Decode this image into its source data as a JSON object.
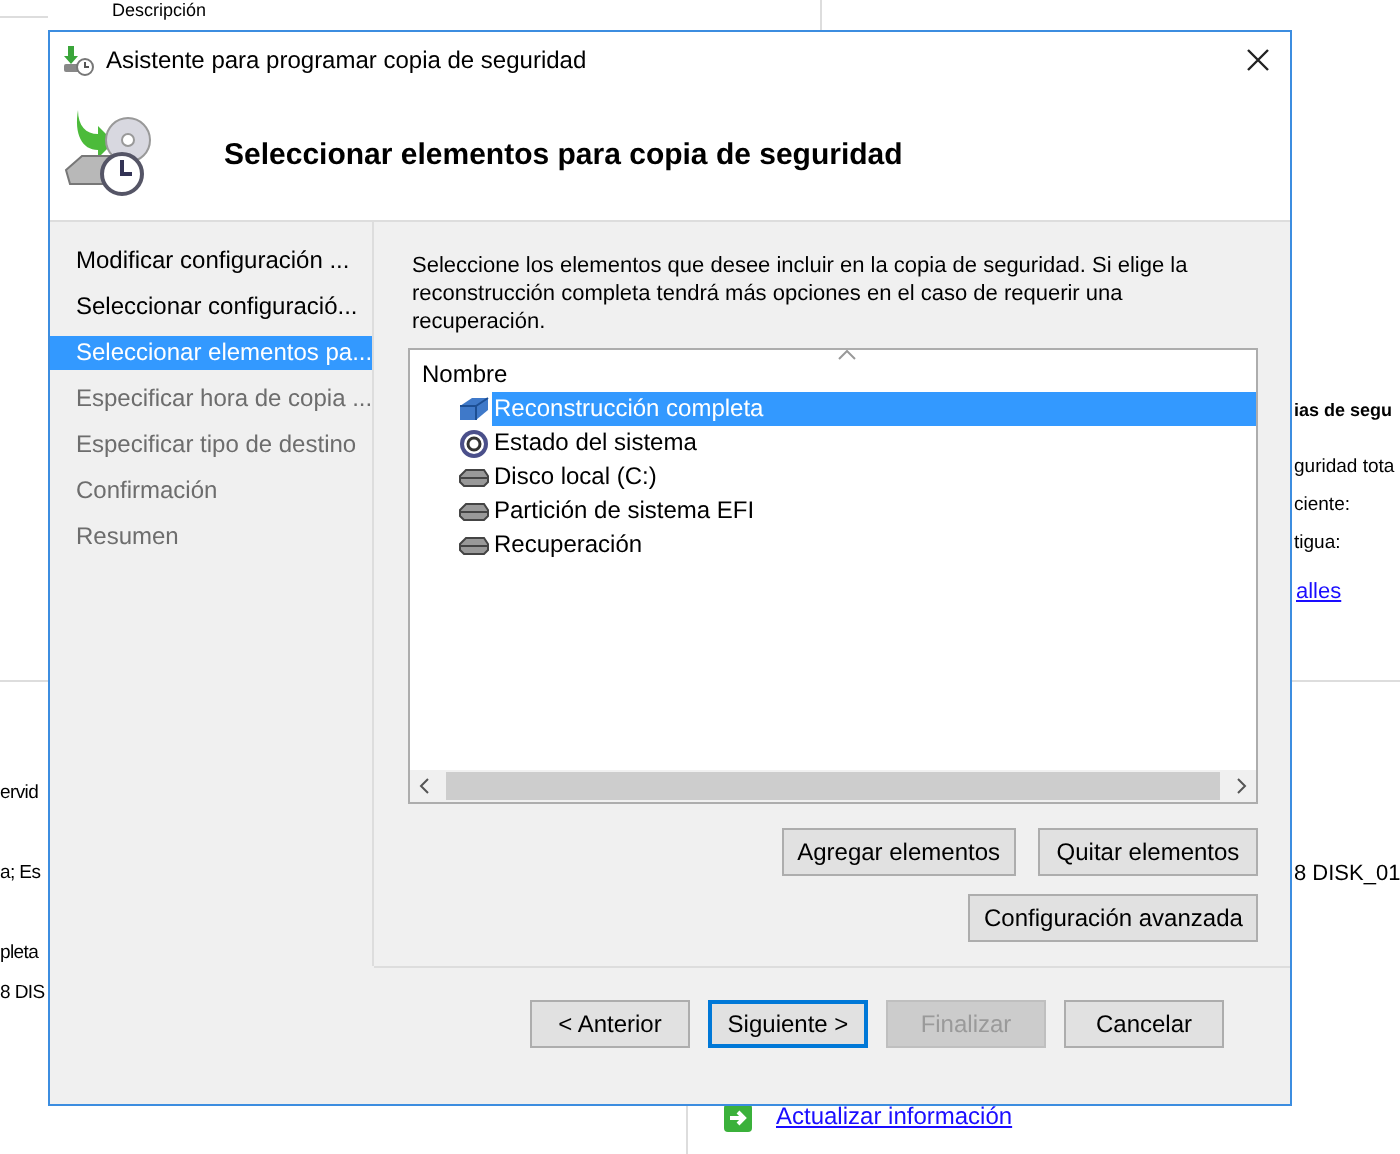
{
  "background_window": {
    "column_header": "Descripción",
    "right_heading": "ias de segu",
    "right_lines": [
      "guridad tota",
      "ciente:",
      "tigua:"
    ],
    "right_link": "alles",
    "right_lower": "8 DISK_01",
    "left_lines": [
      "ervid",
      "a; Es",
      "pleta",
      "8 DIS"
    ],
    "bottom_link": "Actualizar información"
  },
  "dialog": {
    "title": "Asistente para programar copia de seguridad",
    "heading": "Seleccionar elementos para copia de seguridad",
    "steps": [
      {
        "label": "Modificar configuración ...",
        "selected": false,
        "disabled": false
      },
      {
        "label": "Seleccionar configuració...",
        "selected": false,
        "disabled": false
      },
      {
        "label": "Seleccionar elementos pa...",
        "selected": true,
        "disabled": false
      },
      {
        "label": "Especificar hora de copia ...",
        "selected": false,
        "disabled": true
      },
      {
        "label": "Especificar tipo de destino",
        "selected": false,
        "disabled": true
      },
      {
        "label": "Confirmación",
        "selected": false,
        "disabled": true
      },
      {
        "label": "Resumen",
        "selected": false,
        "disabled": true
      }
    ],
    "instructions": "Seleccione los elementos que desee incluir en la copia de seguridad. Si elige la reconstrucción completa tendrá más opciones en el caso de requerir una recuperación.",
    "list": {
      "column": "Nombre",
      "items": [
        {
          "label": "Reconstrucción completa",
          "kind": "bare_metal",
          "selected": true
        },
        {
          "label": "Estado del sistema",
          "kind": "system_state",
          "selected": false
        },
        {
          "label": "Disco local (C:)",
          "kind": "drive",
          "selected": false
        },
        {
          "label": "Partición de sistema EFI",
          "kind": "drive",
          "selected": false
        },
        {
          "label": "Recuperación",
          "kind": "drive",
          "selected": false
        }
      ]
    },
    "item_buttons": [
      {
        "label": "Agregar elementos"
      },
      {
        "label": "Quitar elementos"
      }
    ],
    "advanced_button": {
      "label": "Configuración avanzada"
    },
    "nav_buttons": [
      {
        "label": "< Anterior",
        "disabled": false,
        "default": false
      },
      {
        "label": "Siguiente >",
        "disabled": false,
        "default": true
      },
      {
        "label": "Finalizar",
        "disabled": true,
        "default": false
      },
      {
        "label": "Cancelar",
        "disabled": false,
        "default": false
      }
    ]
  }
}
